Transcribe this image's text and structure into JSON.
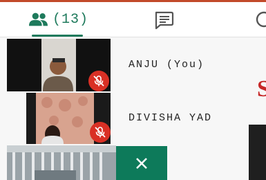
{
  "tabs": {
    "participants_count": "(13)",
    "participants_icon": "people-icon",
    "chat_icon": "chat-icon"
  },
  "participants": [
    {
      "name": "ANJU (You)",
      "muted": true
    },
    {
      "name": "DIVISHA YAD",
      "muted": true
    }
  ],
  "right_edge_letter": "S",
  "colors": {
    "accent": "#1e7a5c",
    "mute": "#d93025",
    "close_tile": "#0d7a5a"
  }
}
